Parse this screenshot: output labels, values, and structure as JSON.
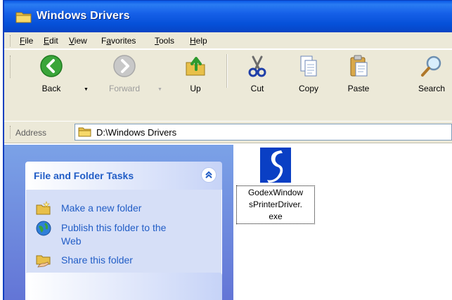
{
  "window": {
    "title": "Windows Drivers",
    "title_icon": "folder-icon"
  },
  "menu": {
    "items": [
      {
        "label": "File",
        "accel": "F"
      },
      {
        "label": "Edit",
        "accel": "E"
      },
      {
        "label": "View",
        "accel": "V"
      },
      {
        "label": "Favorites",
        "accel": "a"
      },
      {
        "label": "Tools",
        "accel": "T"
      },
      {
        "label": "Help",
        "accel": "H"
      }
    ]
  },
  "toolbar": {
    "back": "Back",
    "forward": "Forward",
    "up": "Up",
    "cut": "Cut",
    "copy": "Copy",
    "paste": "Paste",
    "search": "Search"
  },
  "address": {
    "label": "Address",
    "value": "D:\\Windows Drivers"
  },
  "tasks": {
    "header": "File and Folder Tasks",
    "items": [
      {
        "label": "Make a new folder",
        "icon": "new-folder-icon"
      },
      {
        "label_line1": "Publish this folder to the",
        "label_line2": "Web",
        "icon": "publish-web-icon"
      },
      {
        "label": "Share this folder",
        "icon": "share-folder-icon"
      }
    ]
  },
  "files": [
    {
      "name_line1": "GodexWindow",
      "name_line2": "sPrinterDriver.",
      "name_line3": "exe",
      "icon": "installer-exe-icon"
    }
  ],
  "colors": {
    "titlebar": "#0550d8",
    "chrome": "#ece9d8",
    "taskpane": "#6375d6",
    "task_link": "#215dc6"
  }
}
